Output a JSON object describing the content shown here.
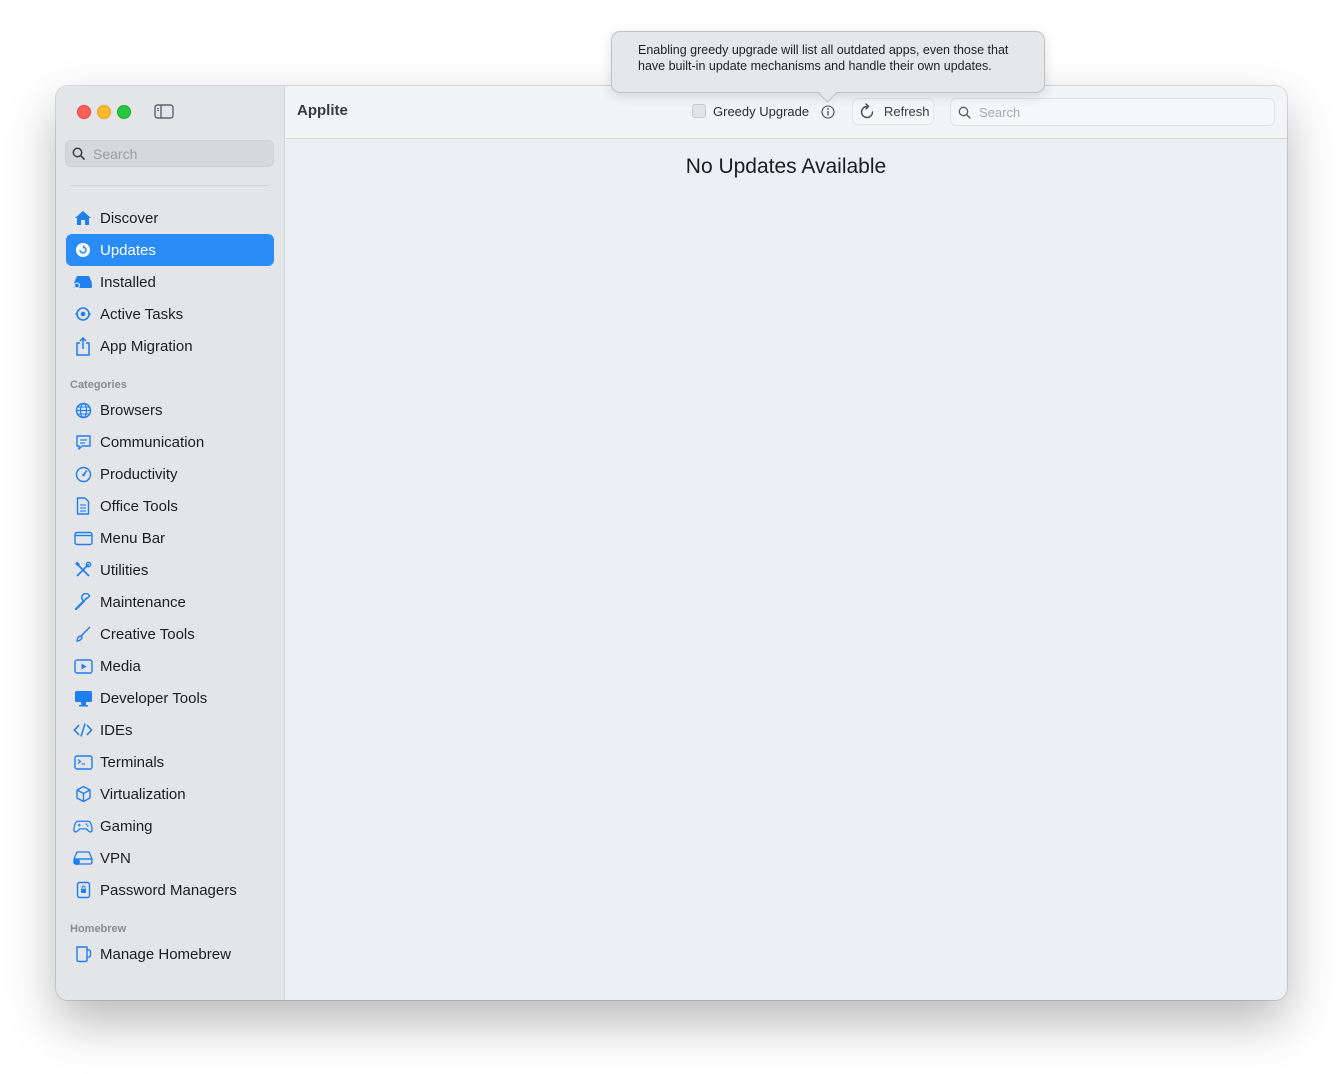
{
  "window": {
    "title": "Applite"
  },
  "tooltip": {
    "text": "Enabling greedy upgrade will list all outdated apps, even those that have built-in update mechanisms and handle their own updates."
  },
  "toolbar": {
    "title": "Applite",
    "greedy_label": "Greedy Upgrade",
    "greedy_checked": false,
    "refresh_label": "Refresh",
    "search_placeholder": "Search"
  },
  "sidebar": {
    "search_placeholder": "Search",
    "main_items": [
      {
        "label": "Discover",
        "icon": "house-icon"
      },
      {
        "label": "Updates",
        "icon": "update-badge-icon",
        "selected": true
      },
      {
        "label": "Installed",
        "icon": "installed-drive-icon"
      },
      {
        "label": "Active Tasks",
        "icon": "active-tasks-icon"
      },
      {
        "label": "App Migration",
        "icon": "share-icon"
      }
    ],
    "categories_header": "Categories",
    "categories": [
      {
        "label": "Browsers",
        "icon": "globe-icon"
      },
      {
        "label": "Communication",
        "icon": "message-icon"
      },
      {
        "label": "Productivity",
        "icon": "speedometer-icon"
      },
      {
        "label": "Office Tools",
        "icon": "document-icon"
      },
      {
        "label": "Menu Bar",
        "icon": "menubar-icon"
      },
      {
        "label": "Utilities",
        "icon": "tools-icon"
      },
      {
        "label": "Maintenance",
        "icon": "wrench-icon"
      },
      {
        "label": "Creative Tools",
        "icon": "paintbrush-icon"
      },
      {
        "label": "Media",
        "icon": "play-rectangle-icon"
      },
      {
        "label": "Developer Tools",
        "icon": "desktop-icon"
      },
      {
        "label": "IDEs",
        "icon": "code-icon"
      },
      {
        "label": "Terminals",
        "icon": "terminal-icon"
      },
      {
        "label": "Virtualization",
        "icon": "cube-icon"
      },
      {
        "label": "Gaming",
        "icon": "gamecontroller-icon"
      },
      {
        "label": "VPN",
        "icon": "vpn-icon"
      },
      {
        "label": "Password Managers",
        "icon": "lock-icon"
      }
    ],
    "homebrew_header": "Homebrew",
    "homebrew_items": [
      {
        "label": "Manage Homebrew",
        "icon": "mug-icon"
      }
    ]
  },
  "content": {
    "empty_message": "No Updates Available"
  },
  "colors": {
    "accent": "#2a8cf6",
    "icon_blue": "#1f7ef0",
    "sidebar_bg": "#e3e5e8",
    "content_bg": "#eceff3"
  }
}
